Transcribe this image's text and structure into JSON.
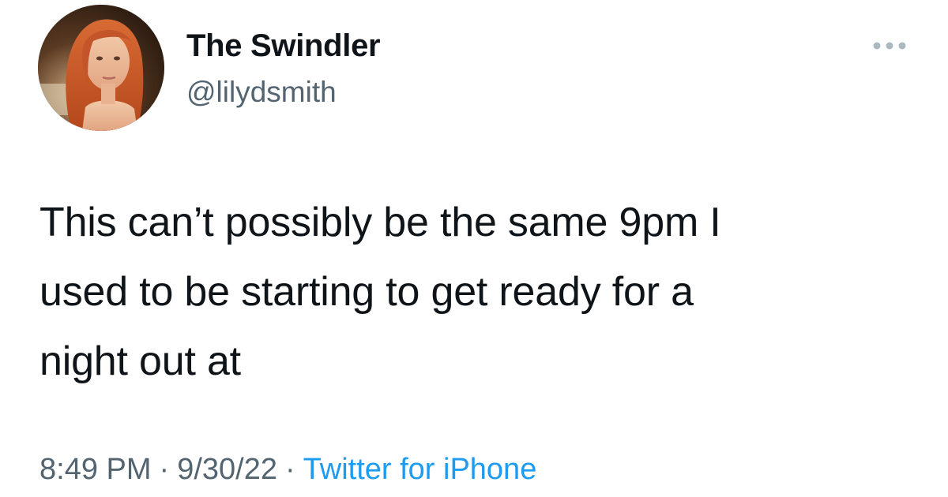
{
  "author": {
    "display_name": "The Swindler",
    "handle": "@lilydsmith"
  },
  "more_icon": "ellipsis-icon",
  "tweet": {
    "lines": [
      "This can’t possibly be the same 9pm I",
      "used to be starting to get ready for a",
      "night out at"
    ]
  },
  "meta": {
    "time": "8:49 PM",
    "date": "9/30/22",
    "separator": "·",
    "source": "Twitter for iPhone"
  },
  "colors": {
    "text_primary": "#0f1419",
    "text_secondary": "#536471",
    "link": "#1d9bf0",
    "background": "#ffffff"
  }
}
